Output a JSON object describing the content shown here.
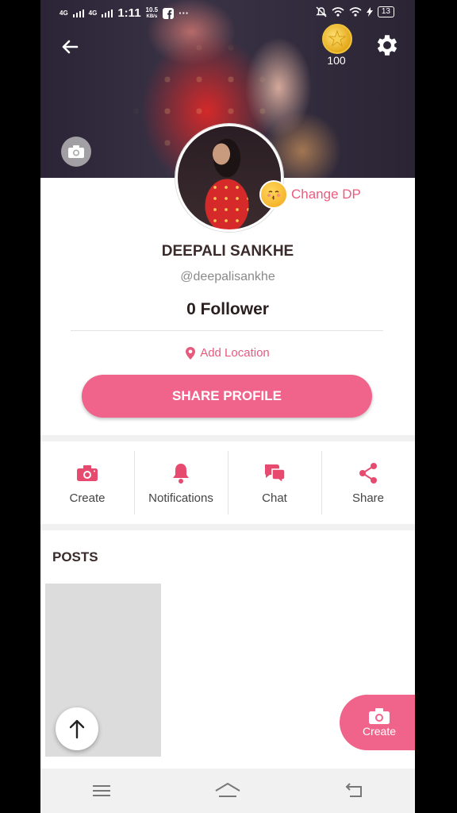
{
  "status_bar": {
    "signal_1": "4G",
    "signal_2": "4G",
    "time": "1:11",
    "speed_value": "10.5",
    "speed_unit": "KB/s",
    "dots": "···",
    "battery": "13"
  },
  "header": {
    "coins": "100"
  },
  "profile": {
    "change_dp_label": "Change DP",
    "name": "DEEPALI SANKHE",
    "handle": "@deepalisankhe",
    "followers": "0 Follower",
    "location_label": "Add Location",
    "share_button": "SHARE PROFILE"
  },
  "actions": [
    {
      "label": "Create",
      "icon": "camera-icon"
    },
    {
      "label": "Notifications",
      "icon": "bell-icon"
    },
    {
      "label": "Chat",
      "icon": "chat-icon"
    },
    {
      "label": "Share",
      "icon": "share-icon"
    }
  ],
  "posts": {
    "title": "POSTS"
  },
  "fab": {
    "label": "Create"
  },
  "colors": {
    "accent": "#f0648c",
    "accent_text": "#e65a7e"
  }
}
